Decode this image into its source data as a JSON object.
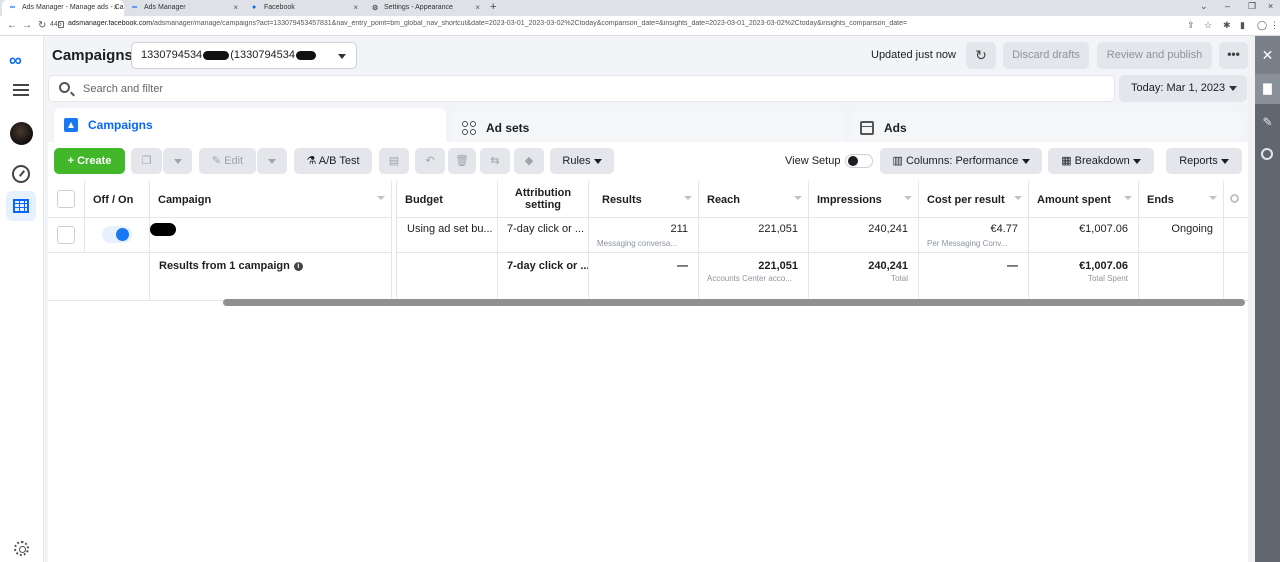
{
  "browser": {
    "tabs": [
      {
        "label": "Ads Manager - Manage ads - Ca"
      },
      {
        "label": "Ads Manager"
      },
      {
        "label": "Facebook"
      },
      {
        "label": "Settings - Appearance"
      }
    ],
    "new_tab": "+",
    "url_prefix": "adsmanager.facebook.com",
    "url_rest": "/adsmanager/manage/campaigns?act=133079453457831&nav_entry_point=bm_global_nav_shortcut&date=2023-03-01_2023-03-02%2Ctoday&comparison_date=&insights_date=2023-03-01_2023-03-02%2Ctoday&insights_comparison_date=",
    "tab_id": "445"
  },
  "header": {
    "title": "Campaigns",
    "account_a": "1330794534",
    "account_b": "(1330794534",
    "updated": "Updated just now",
    "discard": "Discard drafts",
    "review": "Review and publish",
    "more": "•••"
  },
  "search": {
    "placeholder": "Search and filter"
  },
  "date": {
    "label": "Today: Mar 1, 2023"
  },
  "level_tabs": {
    "campaigns": "Campaigns",
    "adsets": "Ad sets",
    "ads": "Ads"
  },
  "toolbar": {
    "create": "+ Create",
    "edit": "Edit",
    "ab_test": "A/B Test",
    "rules": "Rules",
    "view_setup": "View Setup",
    "columns": "Columns: Performance",
    "breakdown": "Breakdown",
    "reports": "Reports"
  },
  "table": {
    "headers": {
      "onoff": "Off / On",
      "campaign": "Campaign",
      "budget": "Budget",
      "attribution": "Attribution setting",
      "results": "Results",
      "reach": "Reach",
      "impressions": "Impressions",
      "cpr": "Cost per result",
      "spent": "Amount spent",
      "ends": "Ends"
    },
    "row": {
      "budget": "Using ad set bu...",
      "attribution": "7-day click or ...",
      "results": "211",
      "results_sub": "Messaging conversa...",
      "reach": "221,051",
      "impressions": "240,241",
      "cpr": "€4.77",
      "cpr_sub": "Per Messaging Conv...",
      "spent": "€1,007.06",
      "ends": "Ongoing"
    },
    "summary": {
      "label": "Results from 1 campaign",
      "attribution": "7-day click or ...",
      "results": "—",
      "reach": "221,051",
      "reach_sub": "Accounts Center acco...",
      "impressions": "240,241",
      "impressions_sub": "Total",
      "cpr": "—",
      "spent": "€1,007.06",
      "spent_sub": "Total Spent"
    }
  }
}
